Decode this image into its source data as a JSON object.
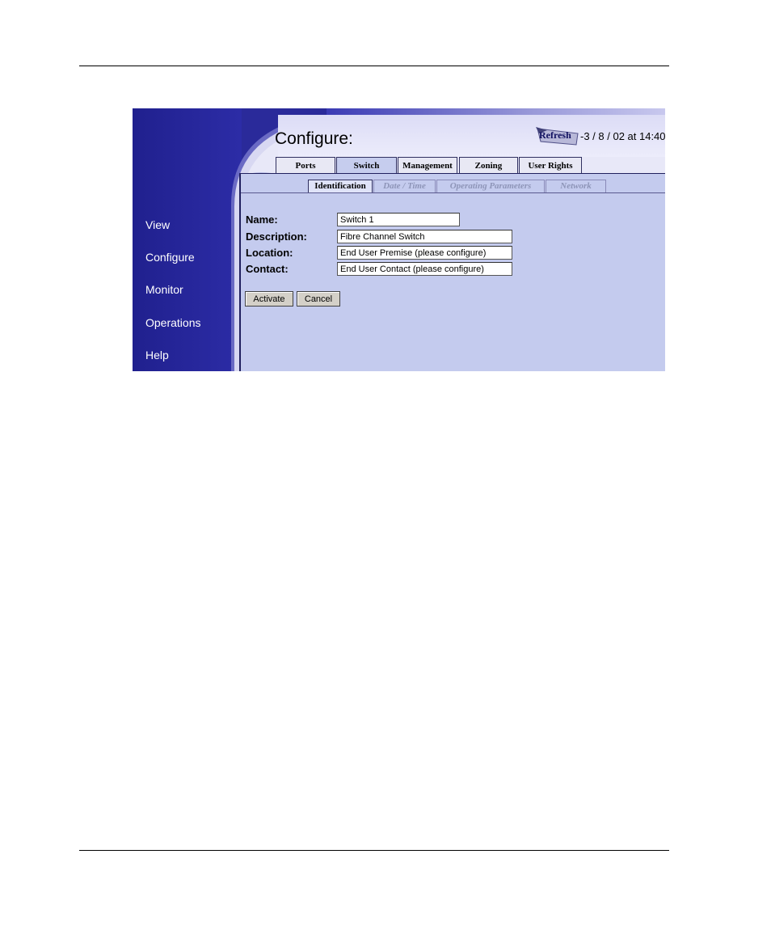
{
  "header": {
    "title": "Configure:",
    "refresh_label": "Refresh",
    "refresh_time": "-3 / 8 / 02 at 14:40"
  },
  "sidebar": {
    "items": [
      {
        "label": "View"
      },
      {
        "label": "Configure"
      },
      {
        "label": "Monitor"
      },
      {
        "label": "Operations"
      },
      {
        "label": "Help"
      }
    ]
  },
  "tabs": [
    {
      "label": "Ports"
    },
    {
      "label": "Switch",
      "active": true
    },
    {
      "label": "Management"
    },
    {
      "label": "Zoning"
    },
    {
      "label": "User Rights"
    }
  ],
  "subtabs": [
    {
      "label": "Identification",
      "active": true
    },
    {
      "label": "Date / Time"
    },
    {
      "label": "Operating Parameters"
    },
    {
      "label": "Network"
    }
  ],
  "form": {
    "name_label": "Name:",
    "name_value": "Switch 1",
    "description_label": "Description:",
    "description_value": "Fibre Channel Switch",
    "location_label": "Location:",
    "location_value": "End User Premise (please configure)",
    "contact_label": "Contact:",
    "contact_value": "End User Contact (please configure)",
    "activate_label": "Activate",
    "cancel_label": "Cancel"
  }
}
